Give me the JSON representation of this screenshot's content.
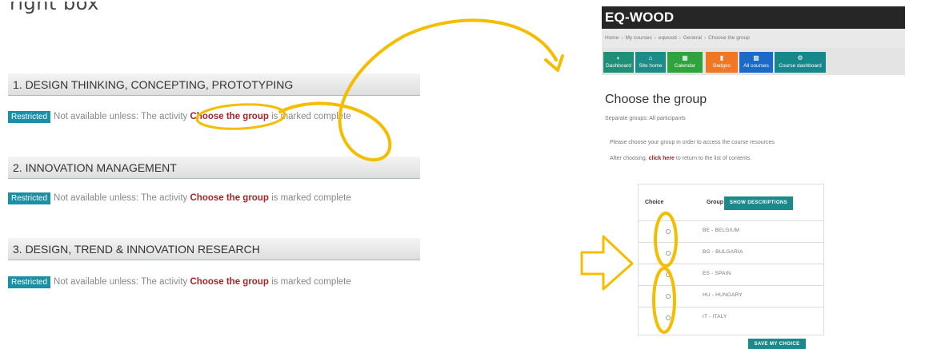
{
  "page": {
    "title": "right box"
  },
  "sections": [
    {
      "title": "1. DESIGN THINKING, CONCEPTING, PROTOTYPING",
      "badge": "Restricted",
      "text_before": "Not available unless: The activity ",
      "activity": "Choose the group",
      "text_after": " is marked complete"
    },
    {
      "title": "2. INNOVATION MANAGEMENT",
      "badge": "Restricted",
      "text_before": "Not available unless: The activity ",
      "activity": "Choose the group",
      "text_after": " is marked complete"
    },
    {
      "title": "3. DESIGN, TREND & INNOVATION RESEARCH",
      "badge": "Restricted",
      "text_before": "Not available unless: The activity ",
      "activity": "Choose the group",
      "text_after": " is marked complete"
    }
  ],
  "app": {
    "title": "EQ-WOOD",
    "breadcrumb": [
      "Home",
      "My courses",
      "eqwood",
      "General",
      "Choose the group"
    ],
    "nav": [
      {
        "label": "Dashboard",
        "icon": "dashboard-icon",
        "color": "#1f8f77"
      },
      {
        "label": "Site home",
        "icon": "home-icon",
        "color": "#1d8b87"
      },
      {
        "label": "Calendar",
        "icon": "calendar-icon",
        "color": "#30a33f"
      },
      {
        "label": "Badges",
        "icon": "bookmark-icon",
        "color": "#f07825"
      },
      {
        "label": "All courses",
        "icon": "book-icon",
        "color": "#1b69c9"
      },
      {
        "label": "Course dashboard",
        "icon": "gears-icon",
        "color": "#15888b"
      }
    ],
    "heading": "Choose the group",
    "separate_groups": "Separate groups: All participants",
    "instruction1": "Please choose your group in order to access the course resources",
    "instruction2_before": "After choosing, ",
    "instruction2_link": "click here",
    "instruction2_after": " to return to the list of contents.",
    "table": {
      "col_choice": "Choice",
      "col_group": "Group",
      "show_descriptions": "SHOW DESCRIPTIONS",
      "rows": [
        "BE - BELGIUM",
        "BG - BULGARIA",
        "ES - SPAIN",
        "HU - HUNGARY",
        "IT - ITALY"
      ]
    },
    "save_button": "SAVE MY CHOICE"
  },
  "colors": {
    "annotation": "#f5bd00",
    "restricted_badge": "#1a8fa6",
    "activity_link": "#a3262a",
    "header_bar": "#262626"
  }
}
